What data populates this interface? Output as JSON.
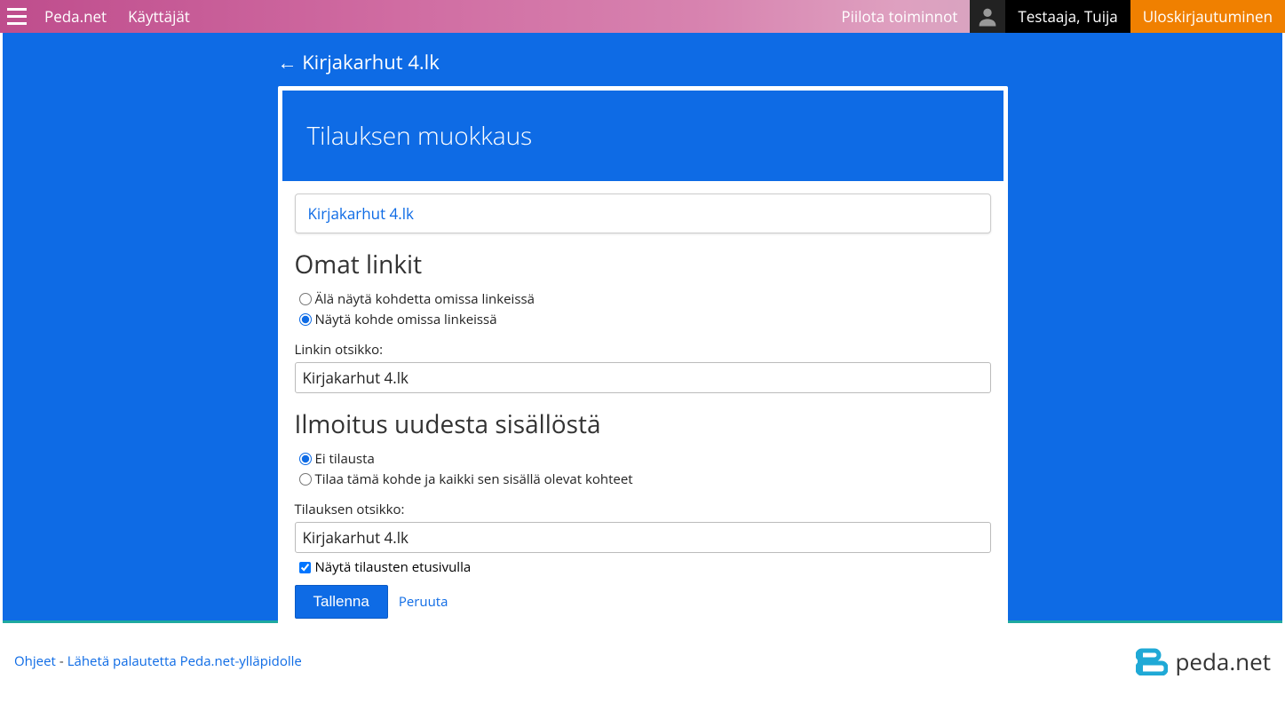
{
  "header": {
    "site": "Peda.net",
    "users": "Käyttäjät",
    "hide_actions": "Piilota toiminnot",
    "user_name": "Testaaja, Tuija",
    "logout": "Uloskirjautuminen"
  },
  "nav": {
    "back_label": "← Kirjakarhut 4.lk"
  },
  "card": {
    "title": "Tilauksen muokkaus",
    "link_box": "Kirjakarhut 4.lk"
  },
  "own_links": {
    "title": "Omat linkit",
    "radio_hide": "Älä näytä kohdetta omissa linkeissä",
    "radio_show": "Näytä kohde omissa linkeissä",
    "link_title_label": "Linkin otsikko:",
    "link_title_value": "Kirjakarhut 4.lk"
  },
  "notification": {
    "title": "Ilmoitus uudesta sisällöstä",
    "radio_none": "Ei tilausta",
    "radio_subscribe": "Tilaa tämä kohde ja kaikki sen sisällä olevat kohteet",
    "sub_title_label": "Tilauksen otsikko:",
    "sub_title_value": "Kirjakarhut 4.lk",
    "show_on_front": "Näytä tilausten etusivulla"
  },
  "actions": {
    "save": "Tallenna",
    "cancel": "Peruuta"
  },
  "footer": {
    "help": "Ohjeet",
    "feedback": "Lähetä palautetta Peda.net-ylläpidolle",
    "brand": "peda.net"
  },
  "state": {
    "own_links_selected": "show",
    "notification_selected": "none",
    "show_on_front_checked": true
  }
}
